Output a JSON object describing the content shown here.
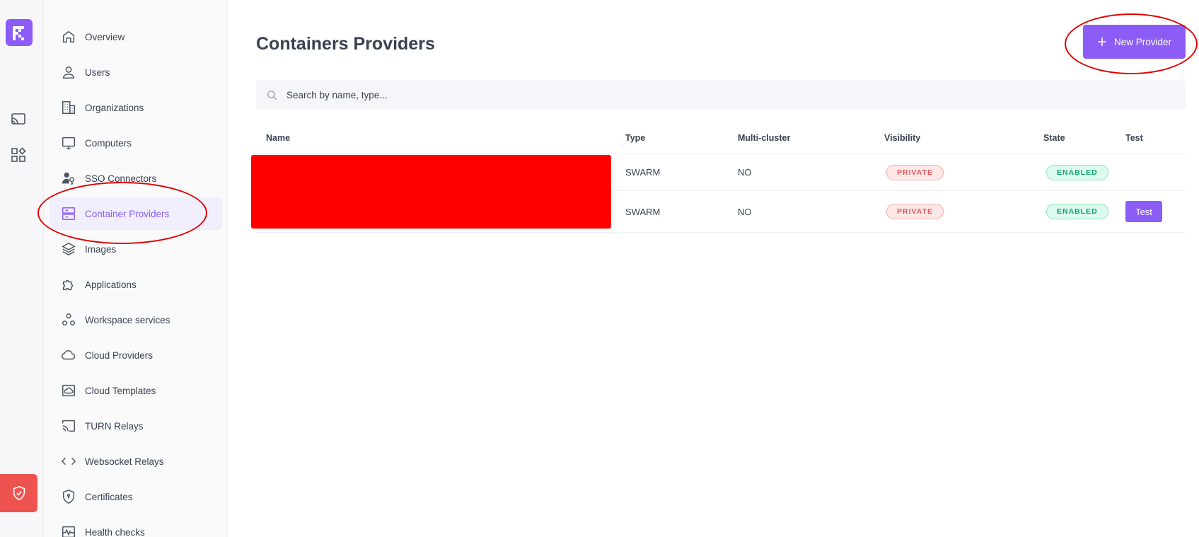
{
  "sidebar": {
    "items": [
      {
        "label": "Overview",
        "icon": "home-icon"
      },
      {
        "label": "Users",
        "icon": "user-icon"
      },
      {
        "label": "Organizations",
        "icon": "building-icon"
      },
      {
        "label": "Computers",
        "icon": "monitor-icon"
      },
      {
        "label": "SSO Connectors",
        "icon": "user-key-icon"
      },
      {
        "label": "Container Providers",
        "icon": "server-icon",
        "active": true
      },
      {
        "label": "Images",
        "icon": "layers-icon"
      },
      {
        "label": "Applications",
        "icon": "puzzle-icon"
      },
      {
        "label": "Workspace services",
        "icon": "circles-icon"
      },
      {
        "label": "Cloud Providers",
        "icon": "cloud-icon"
      },
      {
        "label": "Cloud Templates",
        "icon": "cloud-template-icon"
      },
      {
        "label": "TURN Relays",
        "icon": "cast-icon"
      },
      {
        "label": "Websocket Relays",
        "icon": "code-icon"
      },
      {
        "label": "Certificates",
        "icon": "shield-icon"
      },
      {
        "label": "Health checks",
        "icon": "pulse-icon"
      }
    ]
  },
  "main": {
    "title": "Containers Providers",
    "new_button_label": "New Provider",
    "search_placeholder": "Search by name, type...",
    "columns": [
      "Name",
      "Type",
      "Multi-cluster",
      "Visibility",
      "State",
      "Test"
    ],
    "rows": [
      {
        "name": "",
        "type": "SWARM",
        "multi_cluster": "NO",
        "visibility": "PRIVATE",
        "state": "ENABLED",
        "test": ""
      },
      {
        "name": "",
        "type": "SWARM",
        "multi_cluster": "NO",
        "visibility": "PRIVATE",
        "state": "ENABLED",
        "test": "Test"
      }
    ]
  },
  "colors": {
    "accent": "#8b5cf6",
    "danger": "#ef5350",
    "success": "#10a36a",
    "redaction": "#ff0000",
    "annotation": "#e00000"
  }
}
